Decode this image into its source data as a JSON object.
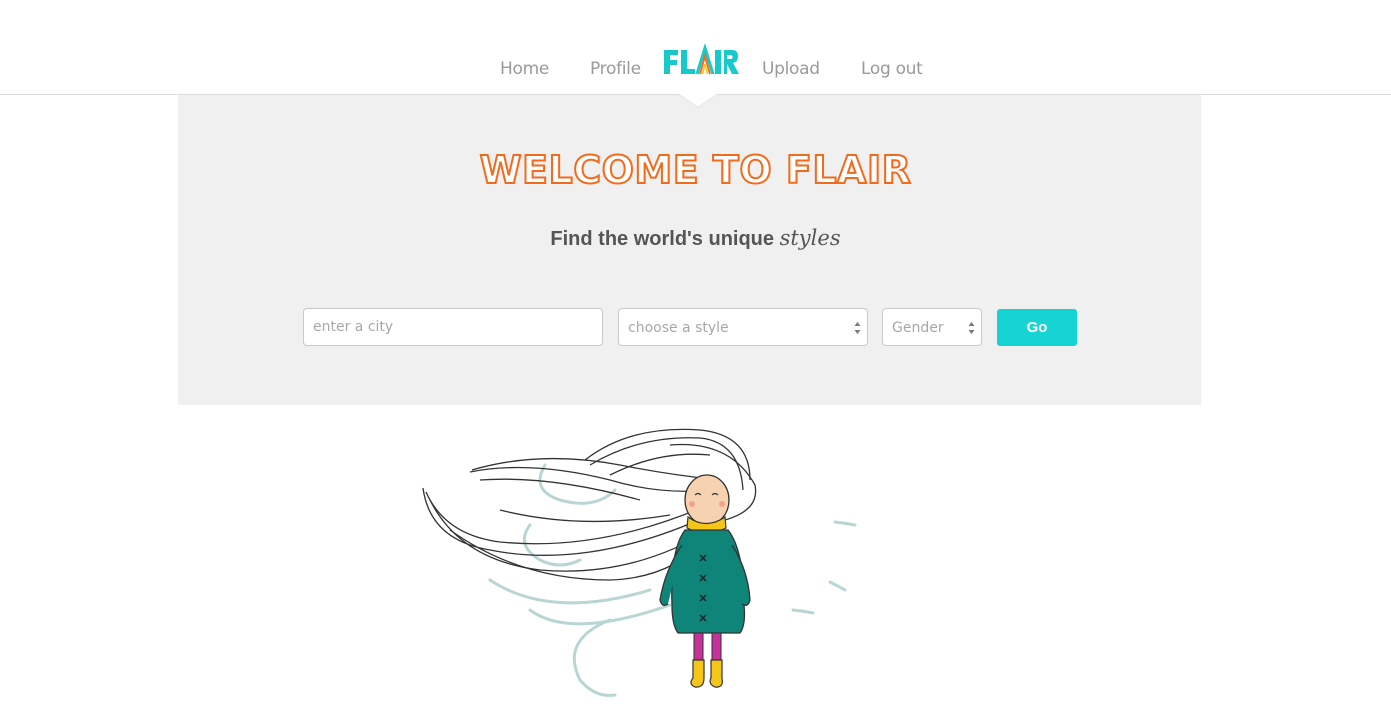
{
  "nav": {
    "home": "Home",
    "profile": "Profile",
    "logo": "FLAIR",
    "upload": "Upload",
    "logout": "Log out"
  },
  "hero": {
    "title": "WELCOME TO FLAIR",
    "subtitle_main": "Find the world's unique",
    "subtitle_script": "styles"
  },
  "search": {
    "city_placeholder": "enter a city",
    "style_selected": "choose a style",
    "gender_selected": "Gender",
    "go_label": "Go"
  },
  "colors": {
    "accent": "#17d4d4",
    "title_orange": "#f26b1d",
    "hero_bg": "#f0f0f0"
  },
  "icons": [
    "flair-logo",
    "select-arrows-icon",
    "girl-illustration"
  ]
}
